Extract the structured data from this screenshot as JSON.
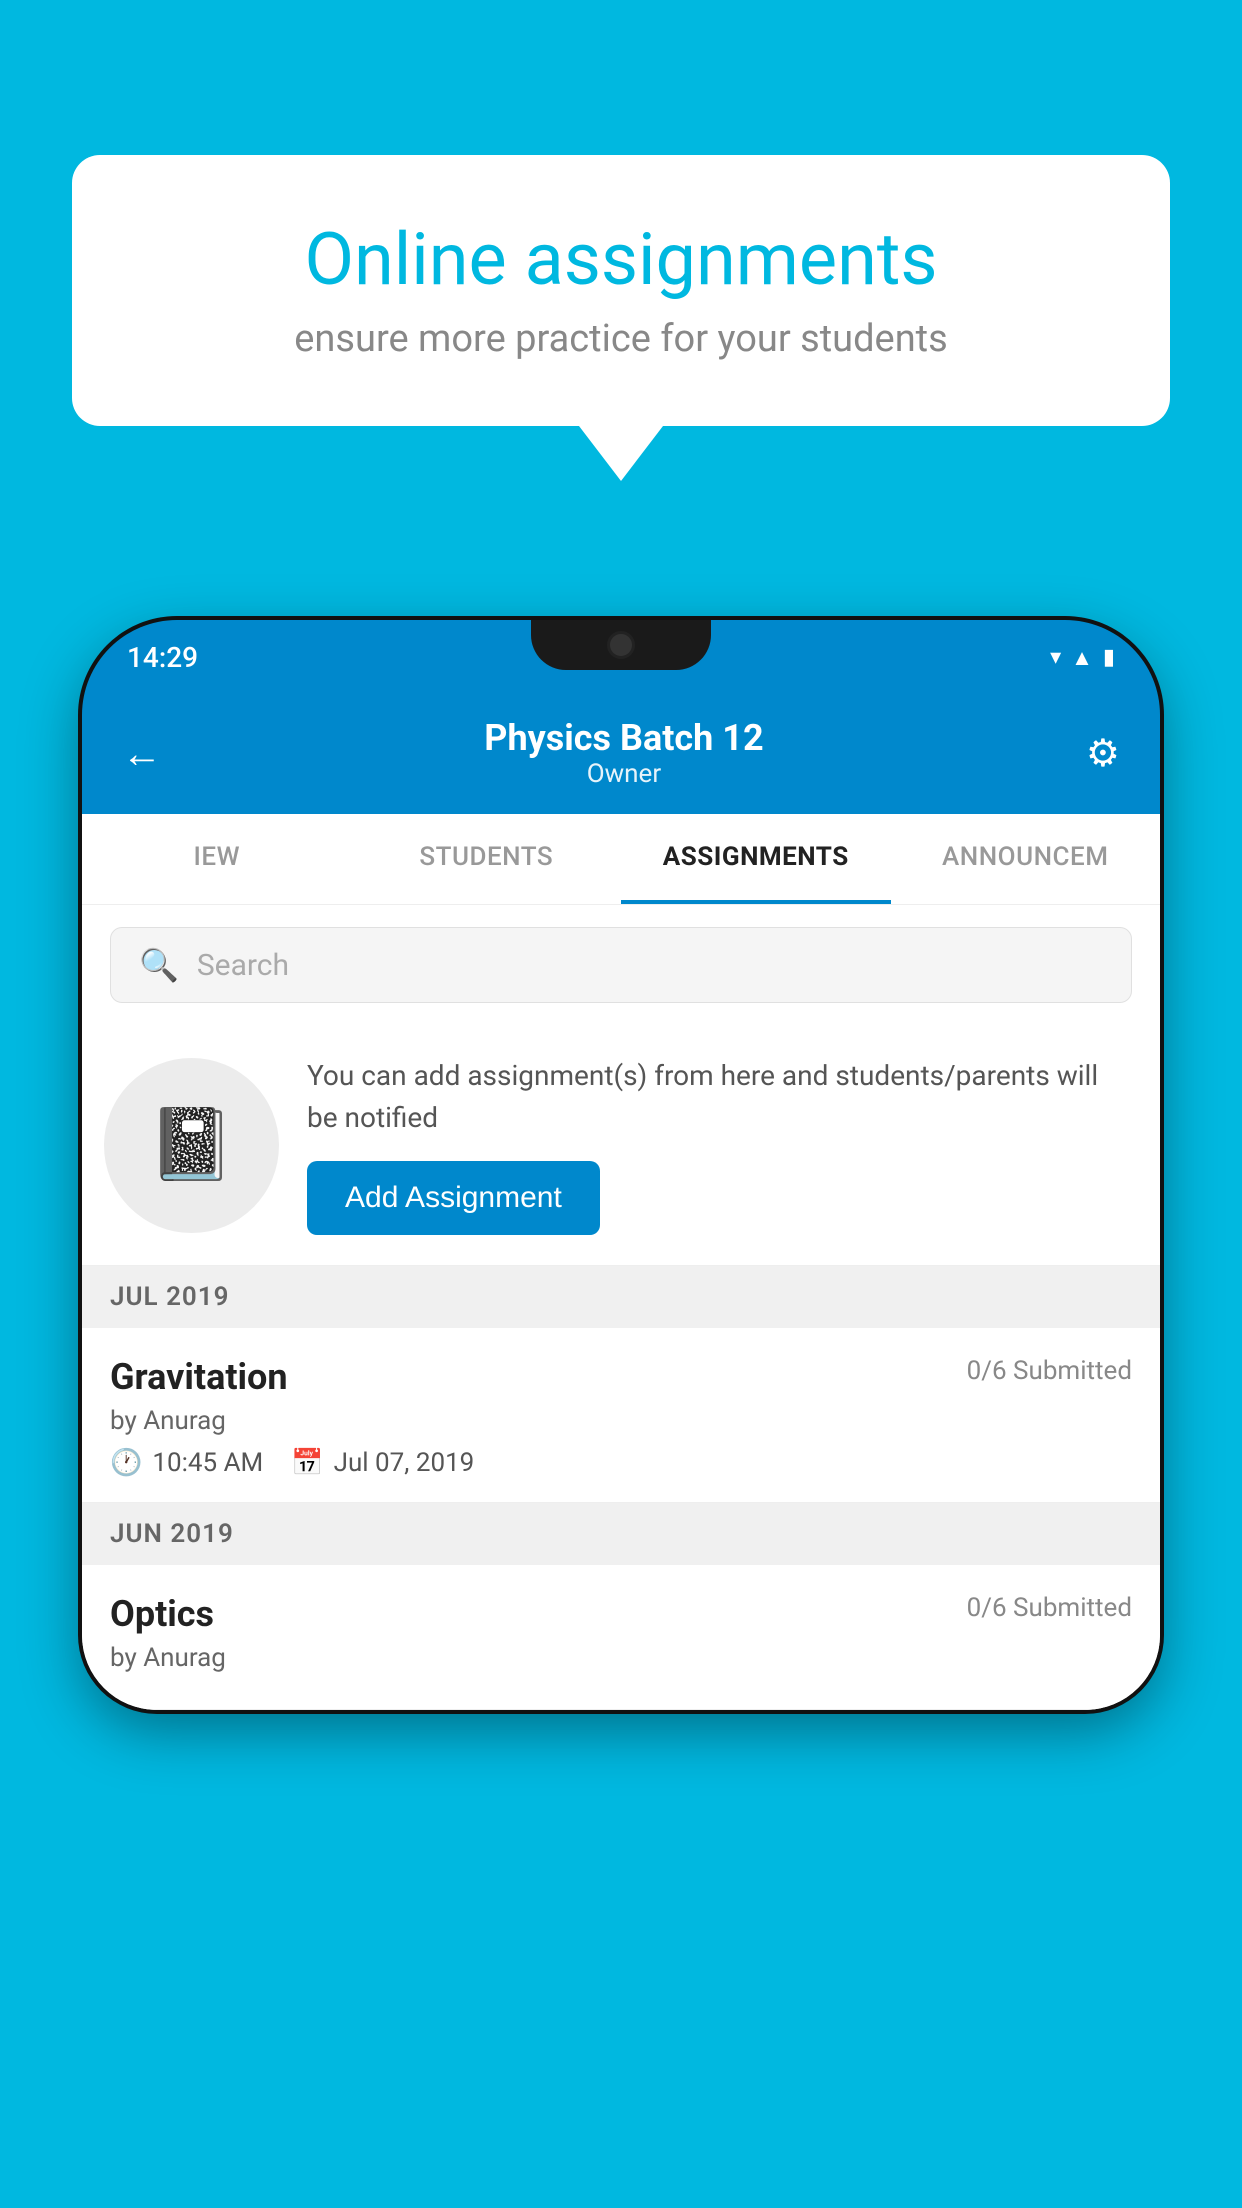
{
  "background_color": "#00B8E0",
  "speech_bubble": {
    "title": "Online assignments",
    "subtitle": "ensure more practice for your students"
  },
  "phone": {
    "time": "14:29",
    "header": {
      "title": "Physics Batch 12",
      "subtitle": "Owner"
    },
    "tabs": [
      {
        "label": "IEW",
        "active": false
      },
      {
        "label": "STUDENTS",
        "active": false
      },
      {
        "label": "ASSIGNMENTS",
        "active": true
      },
      {
        "label": "ANNOUNCEM",
        "active": false
      }
    ],
    "search": {
      "placeholder": "Search"
    },
    "empty_state": {
      "description": "You can add assignment(s) from here and students/parents will be notified",
      "button_label": "Add Assignment"
    },
    "sections": [
      {
        "label": "JUL 2019",
        "assignments": [
          {
            "title": "Gravitation",
            "submitted": "0/6 Submitted",
            "by": "by Anurag",
            "time": "10:45 AM",
            "date": "Jul 07, 2019"
          }
        ]
      },
      {
        "label": "JUN 2019",
        "assignments": [
          {
            "title": "Optics",
            "submitted": "0/6 Submitted",
            "by": "by Anurag",
            "time": "",
            "date": ""
          }
        ]
      }
    ]
  }
}
